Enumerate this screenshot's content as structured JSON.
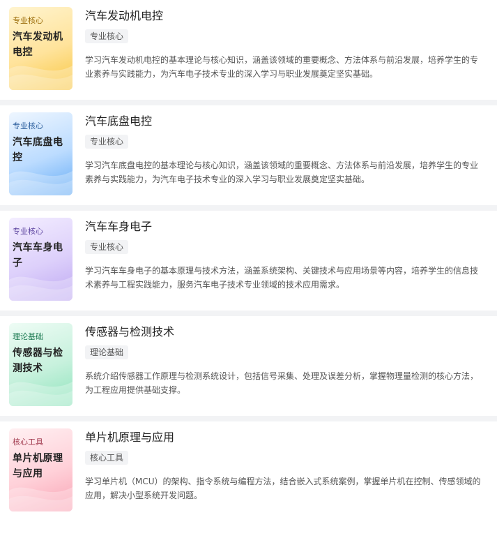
{
  "courses": [
    {
      "cover_tag": "专业核心",
      "cover_title": "汽车发动机电控",
      "title": "汽车发动机电控",
      "badge": "专业核心",
      "description": "学习汽车发动机电控的基本理论与核心知识，涵盖该领域的重要概念、方法体系与前沿发展，培养学生的专业素养与实践能力，为汽车电子技术专业的深入学习与职业发展奠定坚实基础。",
      "theme": "yellow"
    },
    {
      "cover_tag": "专业核心",
      "cover_title": "汽车底盘电控",
      "title": "汽车底盘电控",
      "badge": "专业核心",
      "description": "学习汽车底盘电控的基本理论与核心知识，涵盖该领域的重要概念、方法体系与前沿发展，培养学生的专业素养与实践能力，为汽车电子技术专业的深入学习与职业发展奠定坚实基础。",
      "theme": "blue"
    },
    {
      "cover_tag": "专业核心",
      "cover_title": "汽车车身电子",
      "title": "汽车车身电子",
      "badge": "专业核心",
      "description": "学习汽车车身电子的基本原理与技术方法，涵盖系统架构、关键技术与应用场景等内容，培养学生的信息技术素养与工程实践能力，服务汽车电子技术专业领域的技术应用需求。",
      "theme": "purple"
    },
    {
      "cover_tag": "理论基础",
      "cover_title": "传感器与检测技术",
      "title": "传感器与检测技术",
      "badge": "理论基础",
      "description": "系统介绍传感器工作原理与检测系统设计，包括信号采集、处理及误差分析，掌握物理量检测的核心方法，为工程应用提供基础支撑。",
      "theme": "green"
    },
    {
      "cover_tag": "核心工具",
      "cover_title": "单片机原理与应用",
      "title": "单片机原理与应用",
      "badge": "核心工具",
      "description": "学习单片机（MCU）的架构、指令系统与编程方法，结合嵌入式系统案例，掌握单片机在控制、传感领域的应用，解决小型系统开发问题。",
      "theme": "pink"
    }
  ]
}
